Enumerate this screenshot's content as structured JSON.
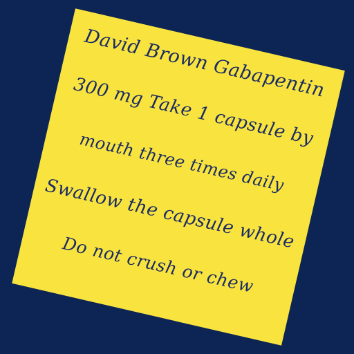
{
  "label": {
    "lines": [
      "David Brown Gabapentin",
      "300 mg Take 1 capsule by",
      "mouth three times daily",
      "Swallow the capsule whole",
      "Do not crush or chew"
    ]
  },
  "colors": {
    "background": "#0d2555",
    "label": "#f9e43f",
    "text": "#1b2c63"
  }
}
